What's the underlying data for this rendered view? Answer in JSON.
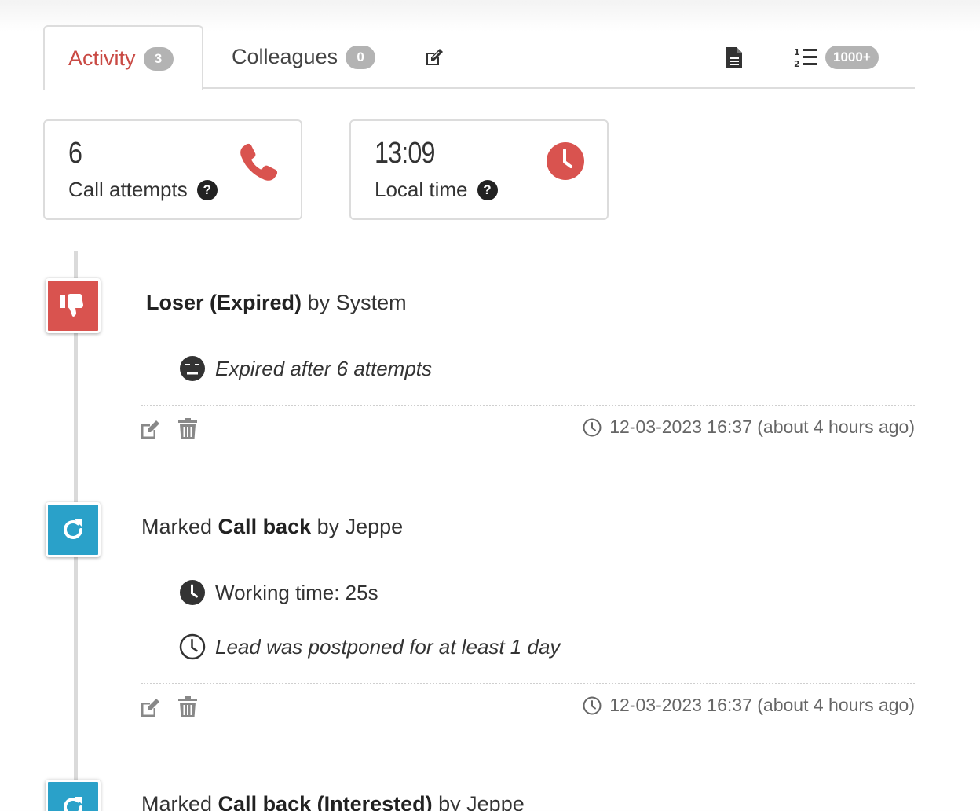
{
  "tabs": {
    "activity": {
      "label": "Activity",
      "badge": "3"
    },
    "colleagues": {
      "label": "Colleagues",
      "badge": "0"
    },
    "edit_icon": "edit-icon",
    "doc_icon": "document-icon",
    "list": {
      "icon": "ordered-list-icon",
      "badge": "1000+"
    }
  },
  "stats": {
    "call_attempts": {
      "value": "6",
      "label": "Call attempts",
      "icon": "phone-icon"
    },
    "local_time": {
      "value": "13:09",
      "label": "Local time",
      "icon": "clock-icon"
    }
  },
  "events": [
    {
      "title_bold": "Loser (Expired)",
      "title_suffix": " by System",
      "icon": "thumbs-down-icon",
      "color": "#d9534f",
      "details": [
        {
          "icon": "neutral-face-icon",
          "text": "Expired after 6 attempts"
        }
      ],
      "timestamp": "12-03-2023 16:37 (about 4 hours ago)"
    },
    {
      "title_prefix": "Marked ",
      "title_bold": "Call back",
      "title_suffix": " by Jeppe",
      "icon": "redo-icon",
      "color": "#2aa1c9",
      "details": [
        {
          "icon": "clock-icon",
          "text": "Working time: 25s"
        },
        {
          "icon": "clock-outline-icon",
          "text": "Lead was postponed for at least 1 day"
        }
      ],
      "timestamp": "12-03-2023 16:37 (about 4 hours ago)"
    },
    {
      "title_prefix": "Marked ",
      "title_bold": "Call back (Interested)",
      "title_suffix": " by Jeppe",
      "icon": "redo-icon",
      "color": "#2aa1c9"
    }
  ],
  "colors": {
    "accent": "#c94a44",
    "badge": "#b3b3b3",
    "blue": "#2aa1c9",
    "red": "#d9534f"
  }
}
